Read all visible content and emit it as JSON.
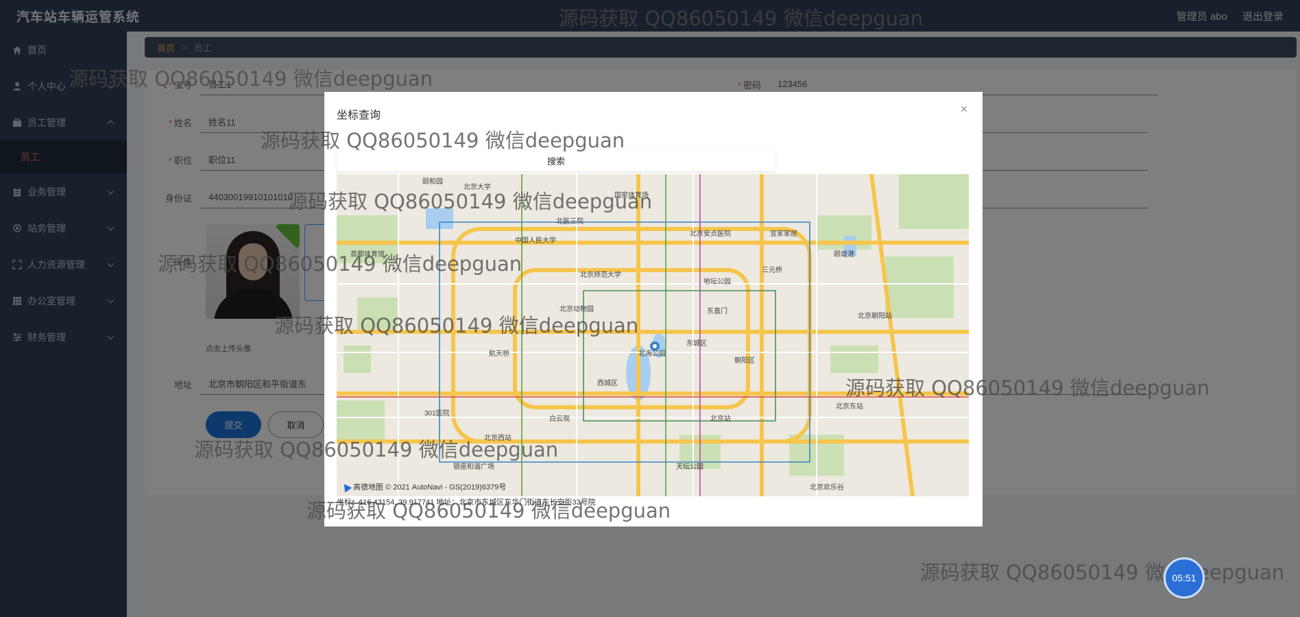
{
  "header": {
    "title": "汽车站车辆运管系统",
    "admin_label": "管理员 abo",
    "logout_label": "退出登录"
  },
  "sidebar": {
    "items": [
      {
        "label": "首页",
        "icon": "home-icon"
      },
      {
        "label": "个人中心",
        "icon": "user-icon"
      },
      {
        "label": "员工管理",
        "icon": "briefcase-icon"
      },
      {
        "label": "员工",
        "icon": ""
      },
      {
        "label": "业务管理",
        "icon": "clipboard-icon"
      },
      {
        "label": "站务管理",
        "icon": "gear-icon"
      },
      {
        "label": "人力资源管理",
        "icon": "expand-icon"
      },
      {
        "label": "办公室管理",
        "icon": "grid-icon"
      },
      {
        "label": "财务管理",
        "icon": "sliders-icon"
      }
    ]
  },
  "breadcrumb": {
    "home": "首页",
    "separator": ">",
    "current": "员工"
  },
  "form": {
    "gonghao_label": "工号",
    "gonghao_value": "员工1",
    "password_label": "密码",
    "password_value": "123456",
    "name_label": "姓名",
    "name_value": "姓名11",
    "position_label": "职位",
    "position_value": "职位11",
    "idcard_label": "身份证",
    "idcard_value": "44030019910101010",
    "avatar_label": "头像",
    "upload_hint": "点击上传头像",
    "address_label": "地址",
    "address_value": "北京市朝阳区和平街道东",
    "submit_label": "提交",
    "cancel_label": "取消"
  },
  "dialog": {
    "title": "坐标查询",
    "close_label": "×",
    "search_label": "搜索",
    "attribution": "高德地图 © 2021 AutoNavi - GS(2019)6379号",
    "coordinate_text": "坐标：116.43154, 39.917741 地址：北京市东城区东华门街道东长安街33号院"
  },
  "map_labels": [
    "颐和园",
    "北京大学",
    "国家体育场",
    "北医三院",
    "北京安贞医院",
    "中国人民大学",
    "北京师范大学",
    "地坛公园",
    "北京动物园",
    "东直门",
    "东城区",
    "朝阳区",
    "西城区",
    "北京站",
    "北京东站",
    "天坛公园",
    "301医院",
    "北京西站",
    "首都体育馆",
    "北京朝阳站",
    "宜家家居",
    "三元桥",
    "航天桥",
    "北海公园",
    "白云观",
    "银座和谐广场",
    "北京欢乐谷",
    "颐堤港"
  ],
  "watermark": "源码获取 QQ86050149 微信deepguan",
  "fab_label": "05:51"
}
